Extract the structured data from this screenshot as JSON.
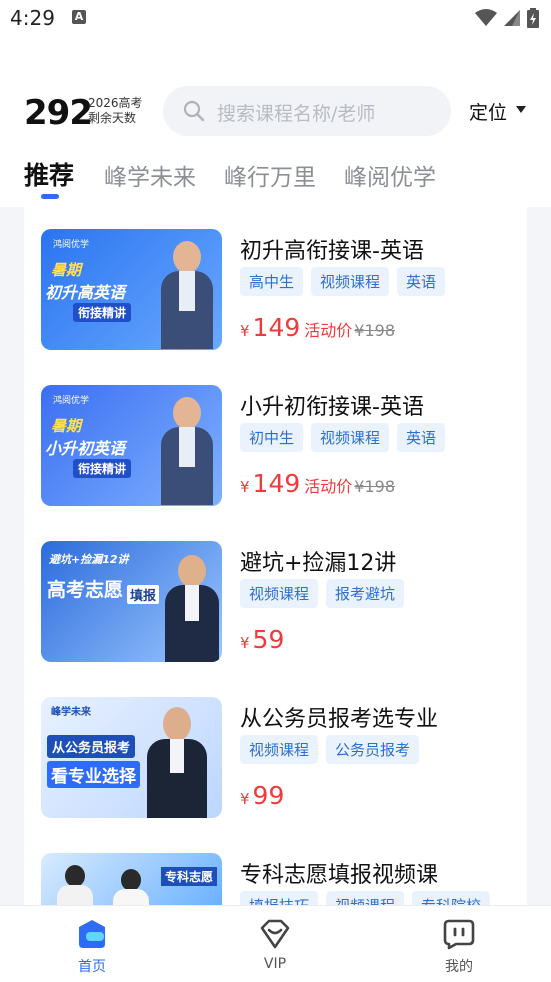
{
  "status": {
    "time": "4:29",
    "notif": "A"
  },
  "header": {
    "days_num": "292",
    "days_line1": "2026高考",
    "days_line2": "剩余天数",
    "search_placeholder": "搜索课程名称/老师",
    "locate": "定位"
  },
  "tabs": [
    "推荐",
    "峰学未来",
    "峰行万里",
    "峰阅优学"
  ],
  "courses": [
    {
      "title": "初升高衔接课-英语",
      "tags": [
        "高中生",
        "视频课程",
        "英语"
      ],
      "yen": "¥",
      "price": "149",
      "promo": "活动价",
      "orig": "¥198",
      "thumb": {
        "brand": "鸿阅优学",
        "line1": "暑期",
        "line2": "初升高英语",
        "line3": "衔接精讲",
        "colors": [
          "#2a74f0",
          "#6aa9ff"
        ]
      }
    },
    {
      "title": "小升初衔接课-英语",
      "tags": [
        "初中生",
        "视频课程",
        "英语"
      ],
      "yen": "¥",
      "price": "149",
      "promo": "活动价",
      "orig": "¥198",
      "thumb": {
        "brand": "鸿阅优学",
        "line1": "暑期",
        "line2": "小升初英语",
        "line3": "衔接精讲",
        "colors": [
          "#3b6ff2",
          "#7fb2ff"
        ]
      }
    },
    {
      "title": "避坑+捡漏12讲",
      "tags": [
        "视频课程",
        "报考避坑"
      ],
      "yen": "¥",
      "price": "59",
      "promo": "",
      "orig": "",
      "thumb": {
        "brand": "",
        "line1": "避坑+捡漏12讲",
        "line2": "高考志愿",
        "line3": "填报",
        "colors": [
          "#2c6bdc",
          "#9cc8ff"
        ]
      }
    },
    {
      "title": "从公务员报考选专业",
      "tags": [
        "视频课程",
        "公务员报考"
      ],
      "yen": "¥",
      "price": "99",
      "promo": "",
      "orig": "",
      "thumb": {
        "brand": "峰学未来",
        "line1": "",
        "line2": "从公务员报考",
        "line3": "看专业选择",
        "colors": [
          "#e9f1ff",
          "#bcd6ff"
        ]
      }
    },
    {
      "title": "专科志愿填报视频课",
      "tags": [
        "填报技巧",
        "视频课程",
        "专科院校"
      ],
      "yen": "",
      "price": "",
      "promo": "",
      "orig": "",
      "thumb": {
        "brand": "",
        "line1": "",
        "line2": "",
        "line3": "专科志愿",
        "colors": [
          "#d9ebff",
          "#4aa0ff"
        ]
      }
    }
  ],
  "nav": [
    {
      "label": "首页",
      "icon": "home-icon",
      "active": true
    },
    {
      "label": "VIP",
      "icon": "vip-icon",
      "active": false
    },
    {
      "label": "我的",
      "icon": "profile-icon",
      "active": false
    }
  ],
  "accent": "#2f6cf6",
  "price_color": "#ee3b3b"
}
